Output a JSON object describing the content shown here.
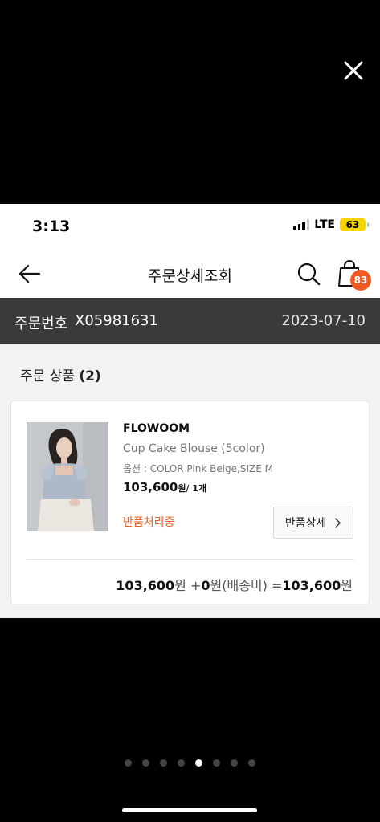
{
  "status_bar": {
    "time": "3:13",
    "network": "LTE",
    "battery": "63"
  },
  "nav": {
    "title": "주문상세조회",
    "cart_count": "83"
  },
  "order": {
    "label": "주문번호",
    "number": "X05981631",
    "date": "2023-07-10"
  },
  "section": {
    "title": "주문 상품",
    "count": "(2)"
  },
  "product": {
    "brand": "FLOWOOM",
    "name": "Cup Cake Blouse (5color)",
    "option": "옵션 : COLOR Pink Beige,SIZE M",
    "price": "103,600",
    "price_unit": "원/ 1개",
    "status": "반품처리중",
    "return_button": "반품상세"
  },
  "summary": {
    "item_price": "103,600",
    "won1": "원 +",
    "shipping": "0",
    "shipping_label": "원(배송비) =",
    "total": "103,600",
    "won2": "원"
  },
  "pagination": {
    "total_pages": 8,
    "active_page": 5
  },
  "colors": {
    "accent": "#f15a22",
    "order_bar": "#3a3a3a",
    "background": "#000000"
  }
}
